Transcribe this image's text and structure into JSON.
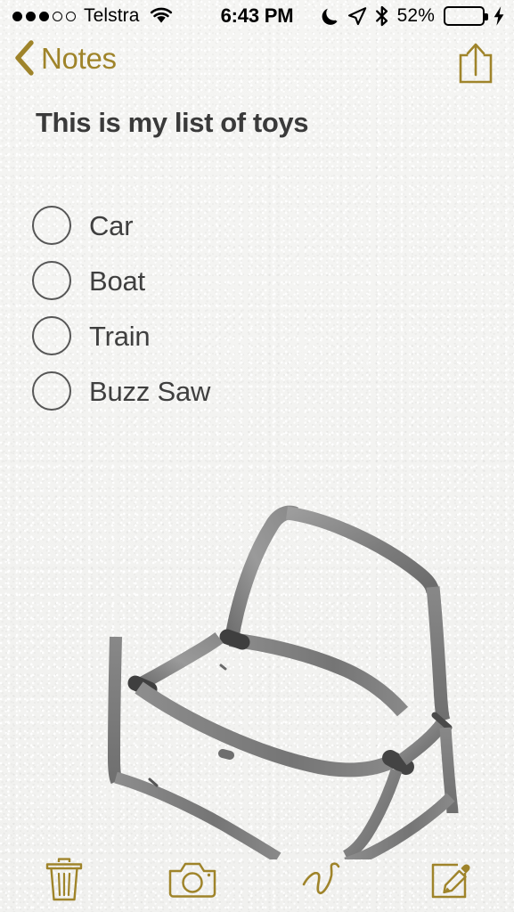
{
  "status_bar": {
    "signal_dots_filled": 3,
    "signal_dots_total": 5,
    "carrier": "Telstra",
    "wifi_icon": "wifi-icon",
    "time": "6:43 PM",
    "do_not_disturb_icon": "moon-icon",
    "location_icon": "location-arrow-icon",
    "bluetooth_icon": "bluetooth-icon",
    "battery_percent_label": "52%",
    "battery_level": 52,
    "battery_fill_color": "#4cd763",
    "charging_icon": "lightning-bolt-icon"
  },
  "nav_bar": {
    "back_icon": "chevron-left-icon",
    "back_label": "Notes",
    "share_icon": "share-icon",
    "tint_color": "#9f842a"
  },
  "note": {
    "title": "This is my list of toys",
    "title_color": "#3a3a3a",
    "checklist": [
      {
        "label": "Car",
        "checked": false
      },
      {
        "label": "Boat",
        "checked": false
      },
      {
        "label": "Train",
        "checked": false
      },
      {
        "label": "Buzz Saw",
        "checked": false
      }
    ],
    "sketch": {
      "name": "hand-drawn-chair-sketch",
      "description": "Hand drawn pencil sketch of a chair",
      "stroke_color": "#808080"
    }
  },
  "toolbar": {
    "items": [
      {
        "icon": "trash-icon",
        "label": "Delete"
      },
      {
        "icon": "camera-icon",
        "label": "Camera"
      },
      {
        "icon": "squiggle-icon",
        "label": "Sketch"
      },
      {
        "icon": "compose-icon",
        "label": "Compose"
      }
    ],
    "tint_color": "#9f842a"
  },
  "page": {
    "background_color": "#f3f3f1"
  }
}
